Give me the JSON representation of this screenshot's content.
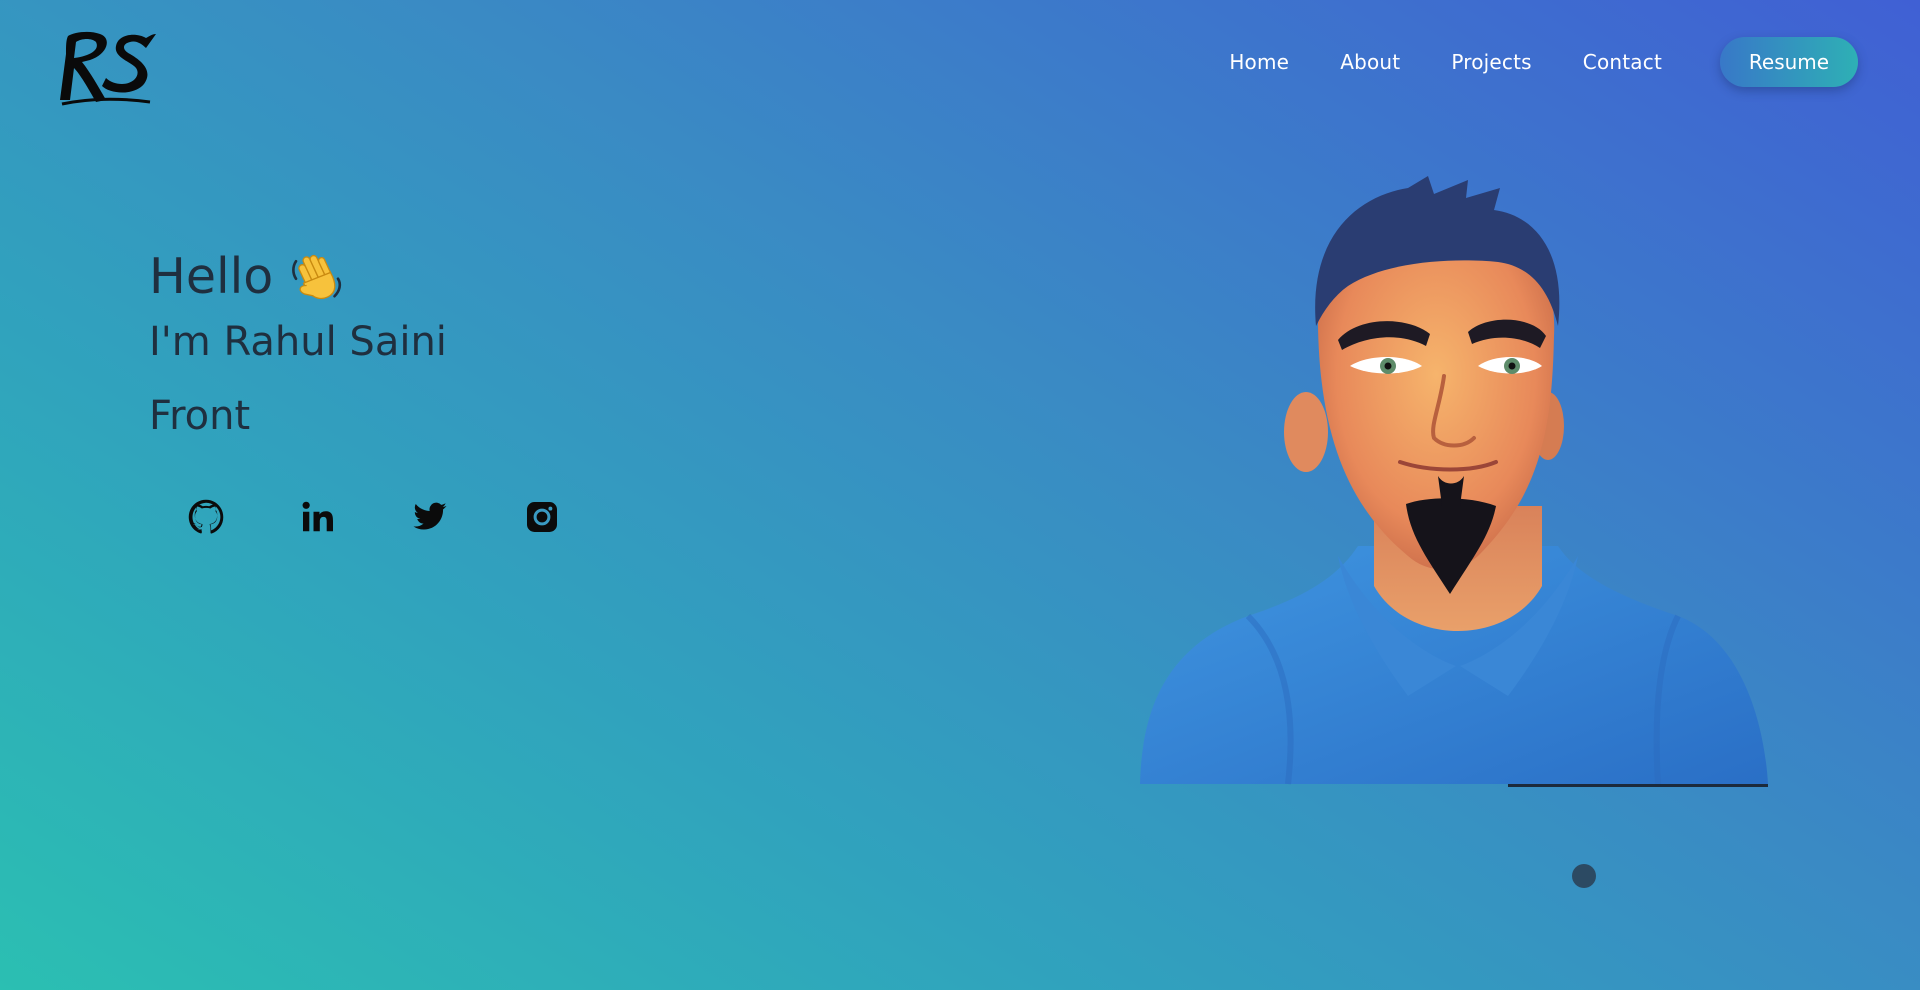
{
  "brand": {
    "logo_text": "RS",
    "logo_icon": "rs-signature-logo"
  },
  "nav": {
    "links": [
      "Home",
      "About",
      "Projects",
      "Contact"
    ],
    "resume_label": "Resume"
  },
  "hero": {
    "greeting": "Hello",
    "greeting_icon": "waving-hand-icon",
    "name_line": "I'm Rahul Saini",
    "role_line": "Front"
  },
  "socials": [
    {
      "icon": "github-icon"
    },
    {
      "icon": "linkedin-icon"
    },
    {
      "icon": "twitter-icon"
    },
    {
      "icon": "instagram-icon"
    }
  ],
  "avatar": {
    "icon": "cartoon-avatar-portrait"
  },
  "colors": {
    "gradient_start": "#2bbfb2",
    "gradient_end": "#4060d4",
    "text": "#1f2f3f",
    "nav_text": "#ffffff",
    "resume_gradient_start": "#3878c8",
    "resume_gradient_end": "#2eb0b5"
  }
}
